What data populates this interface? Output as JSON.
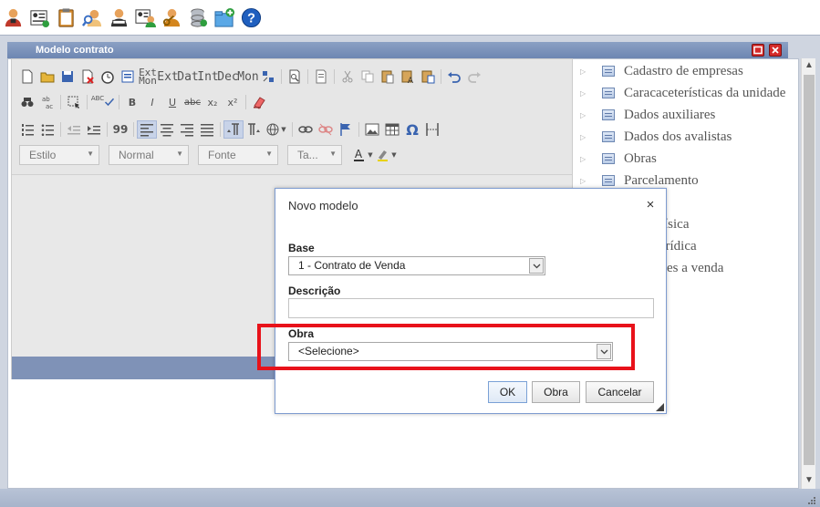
{
  "toolbar": {
    "icons": [
      "user-icon",
      "id-card-icon",
      "clipboard-icon",
      "search-user-icon",
      "user-group-icon",
      "user-card-icon",
      "user-key-icon",
      "database-icon",
      "folder-add-icon",
      "help-icon"
    ],
    "help_label": "?"
  },
  "window": {
    "title": "Modelo contrato"
  },
  "editor": {
    "toolbar_labels": {
      "ext_mon_top": "Ext",
      "ext_mon_bottom": "Mon",
      "ext": "Ext",
      "dat": "Dat",
      "int": "Int",
      "dec": "Dec",
      "mon": "Mon",
      "spell": "ABC",
      "bold": "B",
      "italic": "I",
      "underline": "U",
      "strike": "abc",
      "subscript": "x₂",
      "superscript": "x²",
      "quote": "99",
      "omega": "Ω"
    },
    "combos": {
      "style": "Estilo",
      "format": "Normal",
      "font": "Fonte",
      "size": "Ta..."
    }
  },
  "tree": {
    "items": [
      "Cadastro de empresas",
      "Caracaceterísticas da unidade",
      "Dados auxiliares",
      "Dados dos avalistas",
      "Obras",
      "Parcelamento"
    ],
    "partial_items": [
      "ísica",
      "urídica",
      "es a venda"
    ]
  },
  "dialog": {
    "title": "Novo modelo",
    "close_symbol": "×",
    "base_label": "Base",
    "base_value": "1 - Contrato de Venda",
    "descricao_label": "Descrição",
    "descricao_value": "",
    "obra_label": "Obra",
    "obra_value": "<Selecione>",
    "ok_label": "OK",
    "obra_button_label": "Obra",
    "cancel_label": "Cancelar"
  },
  "colors": {
    "highlight": "#e8121a",
    "window_title": "#6d86b2",
    "dialog_border": "#7d9bd0"
  }
}
